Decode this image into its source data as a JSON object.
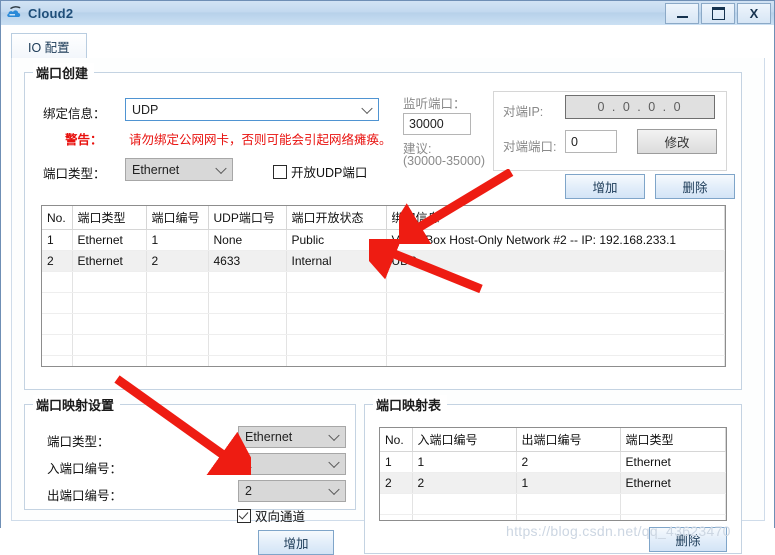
{
  "window": {
    "title": "Cloud2",
    "icon": "cloud-icon",
    "minimize_label": "",
    "maximize_label": "",
    "close_label": "X"
  },
  "tabs": [
    {
      "label": "IO 配置",
      "active": true
    }
  ],
  "port_create": {
    "group_title": "端口创建",
    "bind_info_label": "绑定信息：",
    "bind_info_value": "UDP",
    "warning_label": "警告：",
    "warning_text": "请勿绑定公网网卡，否则可能会引起网络瘫痪。",
    "port_type_label": "端口类型：",
    "port_type_value": "Ethernet",
    "open_udp_label": "开放UDP端口",
    "open_udp_checked": false,
    "listen_port_label": "监听端口：",
    "listen_port_value": "30000",
    "suggest_label": "建议:",
    "suggest_range": "(30000-35000)",
    "peer_ip_label": "对端IP:",
    "peer_ip_value": "0 . 0 . 0 . 0",
    "peer_port_label": "对端端口:",
    "peer_port_value": "0",
    "modify_label": "修改",
    "add_label": "增加",
    "delete_label": "删除"
  },
  "port_table": {
    "columns": [
      "No.",
      "端口类型",
      "端口编号",
      "UDP端口号",
      "端口开放状态",
      "绑定信息"
    ],
    "rows": [
      [
        "1",
        "Ethernet",
        "1",
        "None",
        "Public",
        "VirtualBox Host-Only Network #2 -- IP: 192.168.233.1"
      ],
      [
        "2",
        "Ethernet",
        "2",
        "4633",
        "Internal",
        "UDP"
      ]
    ],
    "empty_rows": 5
  },
  "map_settings": {
    "group_title": "端口映射设置",
    "port_type_label": "端口类型：",
    "port_type_value": "Ethernet",
    "in_port_label": "入端口编号：",
    "in_port_value": "1",
    "out_port_label": "出端口编号：",
    "out_port_value": "2",
    "bidirectional_label": "双向通道",
    "bidirectional_checked": true,
    "add_label": "增加"
  },
  "map_table": {
    "group_title": "端口映射表",
    "columns": [
      "No.",
      "入端口编号",
      "出端口编号",
      "端口类型"
    ],
    "rows": [
      [
        "1",
        "1",
        "2",
        "Ethernet"
      ],
      [
        "2",
        "2",
        "1",
        "Ethernet"
      ]
    ],
    "empty_rows": 3,
    "delete_label": "删除"
  },
  "watermark": "https://blog.csdn.net/qq_43623470"
}
